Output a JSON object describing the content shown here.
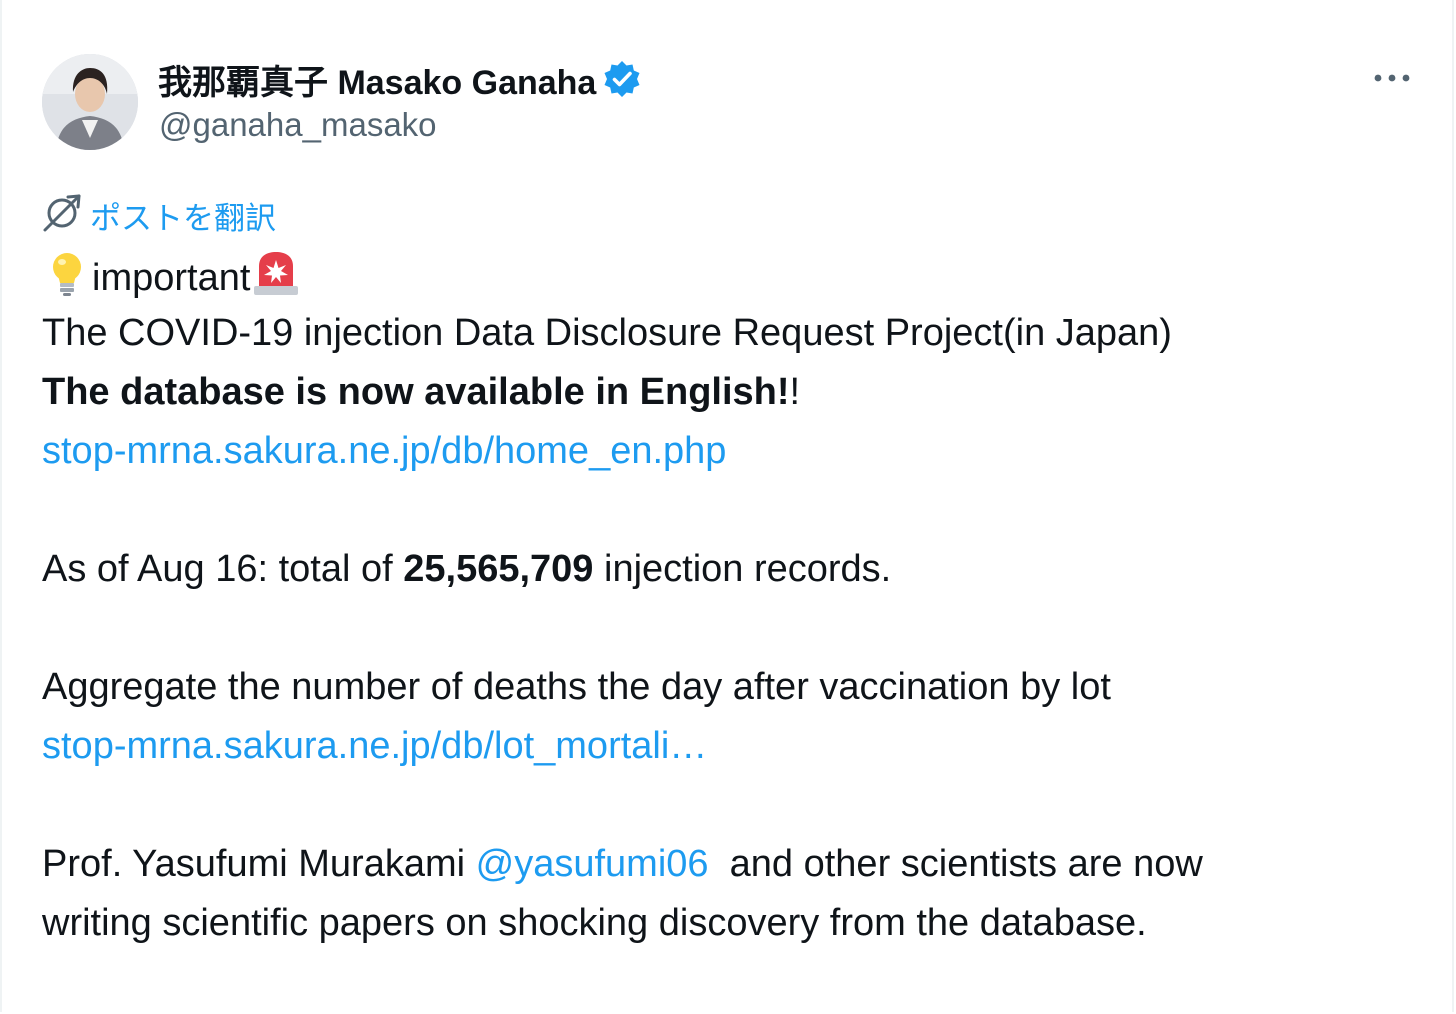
{
  "author": {
    "display_name": "我那覇真子 Masako Ganaha",
    "handle": "@ganaha_masako",
    "verified": true
  },
  "icons": {
    "avatar": "avatar",
    "verified": "verified-badge-icon",
    "more": "more-options-icon",
    "translate": "translate-icon",
    "lightbulb": "lightbulb-emoji",
    "siren": "siren-emoji"
  },
  "colors": {
    "accent": "#1d9bf0",
    "text": "#0f1419",
    "muted": "#536471"
  },
  "translate_label": "ポストを翻訳",
  "tweet": {
    "line1_text": "important",
    "line2": "The COVID-19 injection Data Disclosure Request Project(in Japan)",
    "line3_bold": "The database is now available in English!",
    "line3_rest": "!",
    "link1": "stop-mrna.sakura.ne.jp/db/home_en.php",
    "line5_a": "As of Aug 16: total of ",
    "line5_bold": "25,565,709",
    "line5_b": " injection records.",
    "line7": "Aggregate the number of deaths the day after vaccination by lot",
    "link2": "stop-mrna.sakura.ne.jp/db/lot_mortali…",
    "line9_a": "Prof. Yasufumi Murakami ",
    "mention": "@yasufumi06",
    "line9_b": "  and other scientists are now",
    "line10": "writing scientific papers on shocking discovery from the database."
  }
}
